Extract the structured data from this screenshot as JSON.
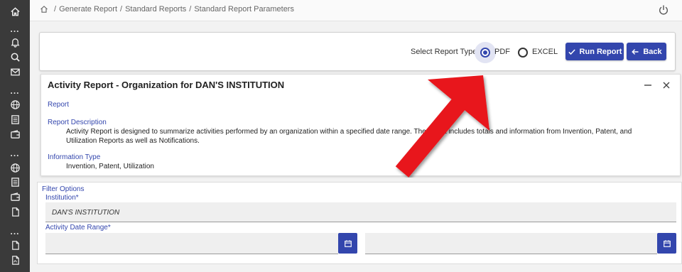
{
  "sidebar": {
    "icons": [
      "home-icon",
      "bell-icon",
      "search-icon",
      "mail-icon",
      "globe-icon",
      "document-icon",
      "wallet-icon",
      "globe-icon",
      "document-icon",
      "wallet-icon",
      "file-icon",
      "file-icon",
      "file-pdf-icon"
    ]
  },
  "breadcrumb": {
    "items": [
      "Generate Report",
      "Standard Reports",
      "Standard Report Parameters"
    ],
    "separator": "/"
  },
  "report_options": {
    "label": "Select Report Type",
    "required_marker": "*",
    "options": [
      {
        "label": "PDF",
        "selected": true
      },
      {
        "label": "EXCEL",
        "selected": false
      }
    ],
    "run_button": "Run Report",
    "back_button": "Back"
  },
  "report_panel": {
    "title": "Activity Report - Organization for DAN'S INSTITUTION",
    "report_label": "Report",
    "description_label": "Report Description",
    "description_line1": "Activity Report is designed to summarize activities performed by an organization within a specified date range. The report includes totals and information from Invention, Patent, and",
    "description_line2": "Utilization Reports as well as Notifications.",
    "info_type_label": "Information Type",
    "info_type_value": "Invention, Patent, Utilization"
  },
  "filter_options": {
    "title": "Filter Options",
    "institution_label": "Institution*",
    "institution_value": "DAN'S INSTITUTION",
    "date_range_label": "Activity Date Range*",
    "start_date": "",
    "end_date": ""
  },
  "colors": {
    "accent": "#3346ad",
    "sidebar": "#3a3a3a",
    "annotation_arrow": "#e8141b"
  }
}
